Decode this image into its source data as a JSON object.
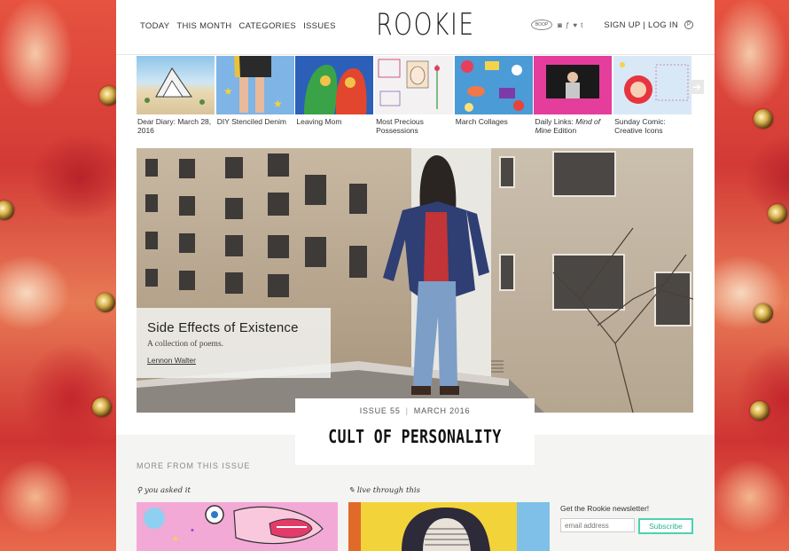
{
  "site": {
    "logo": "ROOKIE"
  },
  "nav": [
    {
      "label": "TODAY"
    },
    {
      "label": "THIS MONTH"
    },
    {
      "label": "CATEGORIES"
    },
    {
      "label": "ISSUES"
    }
  ],
  "header_right": {
    "icons": [
      "boop-badge-icon",
      "instagram-icon",
      "facebook-icon",
      "twitter-icon",
      "tumblr-icon"
    ],
    "boop_text": "BOOP",
    "account_label": "SIGN UP | LOG IN",
    "pinterest_glyph": "P"
  },
  "carousel": {
    "items": [
      {
        "caption": "Dear Diary: March 28, 2016"
      },
      {
        "caption": "DIY Stenciled Denim"
      },
      {
        "caption": "Leaving Mom"
      },
      {
        "caption": "Most Precious Possessions"
      },
      {
        "caption": "March Collages"
      },
      {
        "caption_pre": "Daily Links: ",
        "caption_em": "Mind of Mine",
        "caption_post": " Edition"
      },
      {
        "caption": "Sunday Comic: Creative Icons"
      }
    ],
    "next_icon": "arrow-right-icon"
  },
  "hero": {
    "title": "Side Effects of Existence",
    "subtitle": "A collection of poems.",
    "author": "Lennon Walter"
  },
  "issue": {
    "number": "ISSUE 55",
    "date": "MARCH 2016",
    "title": "CULT OF PERSONALITY"
  },
  "more": {
    "heading": "MORE FROM THIS ISSUE",
    "tags": [
      "you asked it",
      "live through this"
    ]
  },
  "newsletter": {
    "label": "Get the Rookie newsletter!",
    "placeholder": "email address",
    "button": "Subscribe"
  },
  "colors": {
    "accent": "#4dd1b0",
    "background": "#d9443a"
  }
}
